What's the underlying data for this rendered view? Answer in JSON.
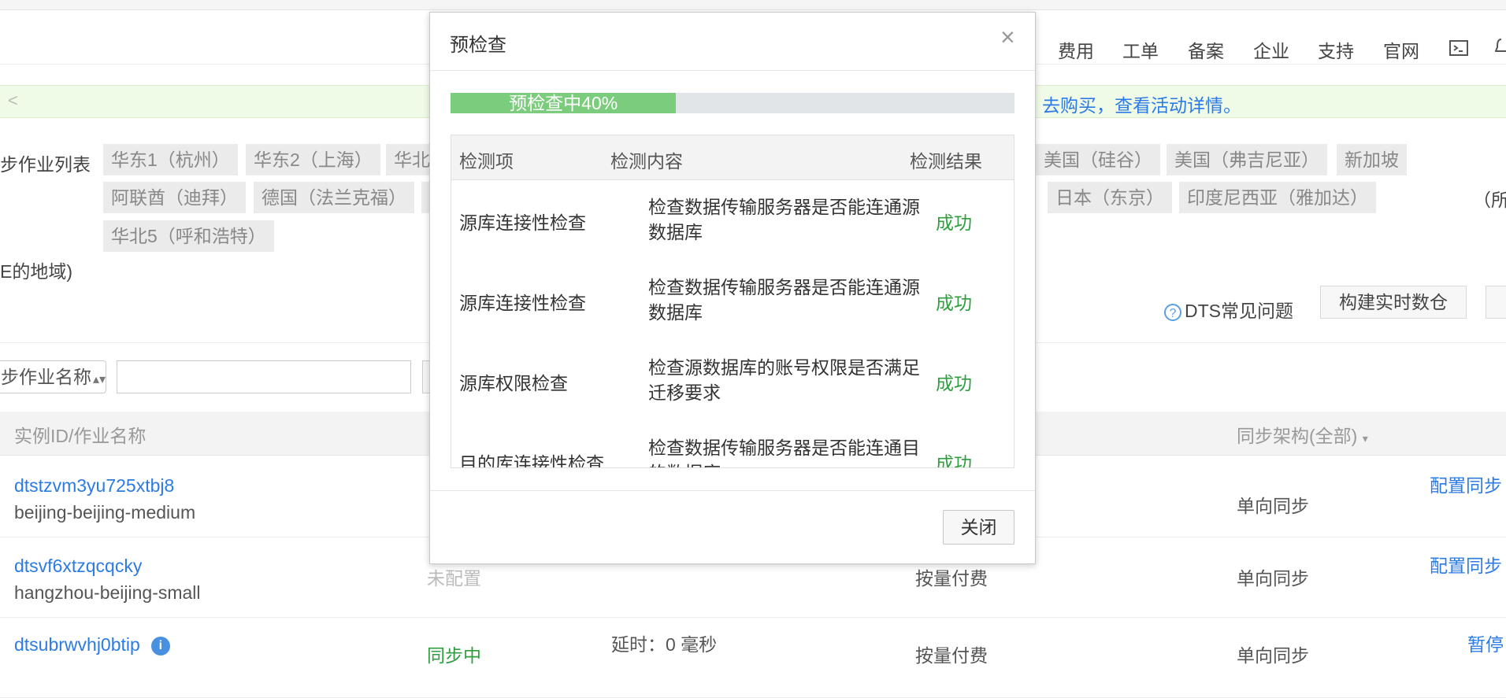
{
  "topnav": [
    "费用",
    "工单",
    "备案",
    "企业",
    "支持",
    "官网"
  ],
  "banner": {
    "prev": "<",
    "text": "去购买，查看活动详情。"
  },
  "regions": {
    "label": "步作业列表",
    "label_end": "E的地域)",
    "note": "（所",
    "tags_row1": [
      "华东1（杭州）",
      "华东2（上海）",
      "华北",
      "美国（硅谷）",
      "美国（弗吉尼亚）",
      "新加坡"
    ],
    "tags_row2": [
      "阿联酋（迪拜）",
      "德国（法兰克福）",
      "日本（东京）",
      "印度尼西亚（雅加达）"
    ],
    "tags_row3": [
      "华北5（呼和浩特）"
    ]
  },
  "help_link": "DTS常见问题",
  "build_button": "构建实时数仓",
  "search": {
    "select_label": "步作业名称",
    "value": ""
  },
  "table": {
    "headers": {
      "id": "实例ID/作业名称",
      "arch": "同步架构(全部)"
    },
    "rows": [
      {
        "id": "dtstzvm3yu725xtbj8",
        "name": "beijing-beijing-medium",
        "status": "",
        "billing": "",
        "arch": "单向同步",
        "action": "配置同步"
      },
      {
        "id": "dtsvf6xtzqcqcky",
        "name": "hangzhou-beijing-small",
        "status": "未配置",
        "billing": "按量付费",
        "arch": "单向同步",
        "action": "配置同步"
      },
      {
        "id": "dtsubrwvhj0btip",
        "name": "",
        "status": "同步中",
        "delay": "延时：0 毫秒",
        "billing": "按量付费",
        "arch": "单向同步",
        "action": "暂停"
      }
    ]
  },
  "modal": {
    "title": "预检查",
    "close_icon": "×",
    "progress": {
      "percent": 40,
      "text": "预检查中40%"
    },
    "headers": [
      "检测项",
      "检测内容",
      "检测结果"
    ],
    "rows": [
      {
        "item": "源库连接性检查",
        "content": "检查数据传输服务器是否能连通源数据库",
        "result": "成功"
      },
      {
        "item": "源库连接性检查",
        "content": "检查数据传输服务器是否能连通源数据库",
        "result": "成功"
      },
      {
        "item": "源库权限检查",
        "content": "检查源数据库的账号权限是否满足迁移要求",
        "result": "成功"
      },
      {
        "item": "目的库连接性检查",
        "content": "检查数据传输服务器是否能连通目的数据库",
        "result": "成功"
      }
    ],
    "close_button": "关闭"
  }
}
